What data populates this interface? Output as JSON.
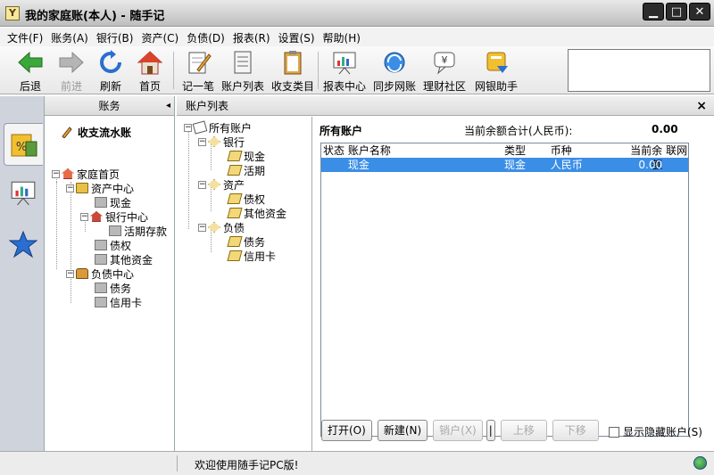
{
  "window": {
    "title": "我的家庭账(本人) - 随手记"
  },
  "menu": [
    "文件(F)",
    "账务(A)",
    "银行(B)",
    "资产(C)",
    "负债(D)",
    "报表(R)",
    "设置(S)",
    "帮助(H)"
  ],
  "toolbar": {
    "back": "后退",
    "forward": "前进",
    "refresh": "刷新",
    "home": "首页",
    "record": "记一笔",
    "account_list": "账户列表",
    "categories": "收支类目",
    "reports": "报表中心",
    "sync": "同步网账",
    "community": "理财社区",
    "bank_helper": "网银助手"
  },
  "left_panel": {
    "header": "账务",
    "cashflow": "收支流水账",
    "tree": {
      "home": "家庭首页",
      "assets_center": "资产中心",
      "cash": "现金",
      "bank_center": "银行中心",
      "demand": "活期存款",
      "bond": "债权",
      "other_funds": "其他资金",
      "liab_center": "负债中心",
      "debt": "债务",
      "credit_card": "信用卡"
    }
  },
  "list_panel": {
    "header": "账户列表",
    "tree": {
      "all": "所有账户",
      "bank": "银行",
      "cash": "现金",
      "demand": "活期",
      "assets": "资产",
      "bond": "债权",
      "other": "其他资金",
      "liabilities": "负债",
      "debt": "债务",
      "credit": "信用卡"
    },
    "detail": {
      "title": "所有账户",
      "total_label": "当前余额合计(人民币):",
      "total_value": "0.00",
      "columns": [
        "状态",
        "账户名称",
        "类型",
        "币种",
        "当前余额",
        "联网"
      ],
      "rows": [
        {
          "status": "",
          "name": "现金",
          "type": "现金",
          "currency": "人民币",
          "balance": "0.00",
          "online": ""
        }
      ]
    },
    "buttons": {
      "open": "打开(O)",
      "new": "新建(N)",
      "close_acct": "销户(X)",
      "more": "|",
      "up": "上移",
      "down": "下移"
    },
    "show_hidden": "显示隐藏账户(S)"
  },
  "statusbar": {
    "text": "欢迎使用随手记PC版!"
  },
  "colors": {
    "selection": "#3a8ee6"
  }
}
